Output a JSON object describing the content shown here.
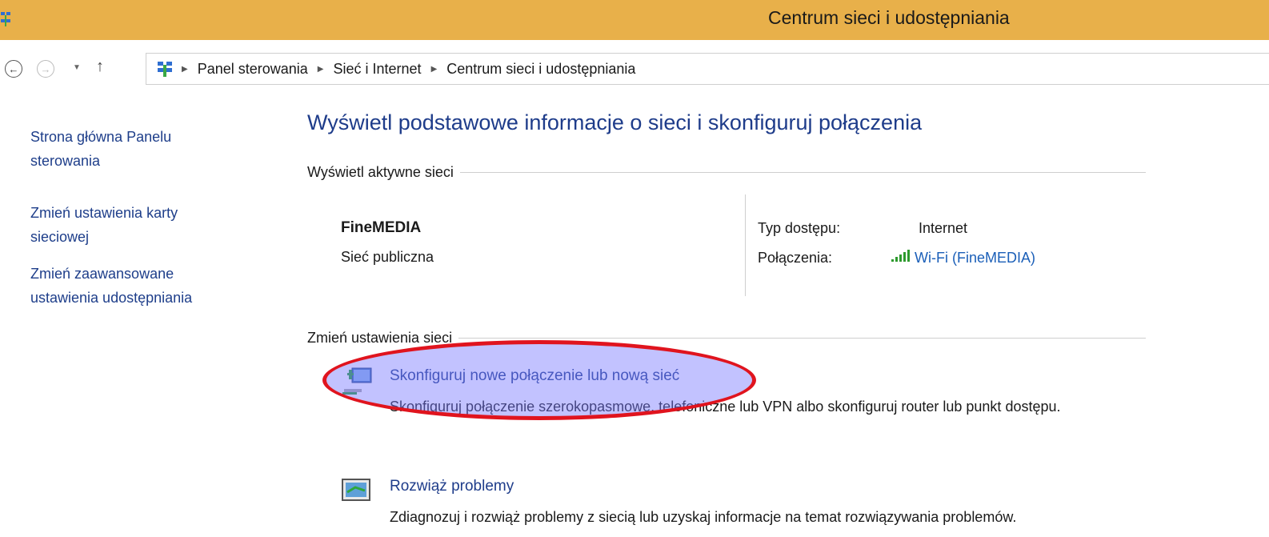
{
  "window": {
    "title": "Centrum sieci i udostępniania"
  },
  "address": {
    "breadcrumbs": [
      "Panel sterowania",
      "Sieć i Internet",
      "Centrum sieci i udostępniania"
    ]
  },
  "sidebar": {
    "items": [
      {
        "label": "Strona główna Panelu sterowania"
      },
      {
        "label": "Zmień ustawienia karty sieciowej"
      },
      {
        "label": "Zmień zaawansowane ustawienia udostępniania"
      }
    ]
  },
  "main": {
    "title": "Wyświetl podstawowe informacje o sieci i skonfiguruj połączenia",
    "active_networks_header": "Wyświetl aktywne sieci",
    "network": {
      "name": "FineMEDIA",
      "type": "Sieć publiczna",
      "access_label": "Typ dostępu:",
      "access_value": "Internet",
      "connections_label": "Połączenia:",
      "connections_value": "Wi-Fi (FineMEDIA)"
    },
    "change_settings_header": "Zmień ustawienia sieci",
    "tasks": [
      {
        "link": "Skonfiguruj nowe połączenie lub nową sieć",
        "description": "Skonfiguruj połączenie szerokopasmowe, telefoniczne lub VPN albo skonfiguruj router lub punkt dostępu.",
        "icon": "new-connection-icon"
      },
      {
        "link": "Rozwiąż problemy",
        "description": "Zdiagnozuj i rozwiąż problemy z siecią lub uzyskaj informacje na temat rozwiązywania problemów.",
        "icon": "troubleshoot-icon"
      }
    ]
  },
  "colors": {
    "titlebar": "#e8b04a",
    "link": "#1e3c8a",
    "highlight_border": "#e0141e",
    "highlight_fill": "#7878ff"
  }
}
